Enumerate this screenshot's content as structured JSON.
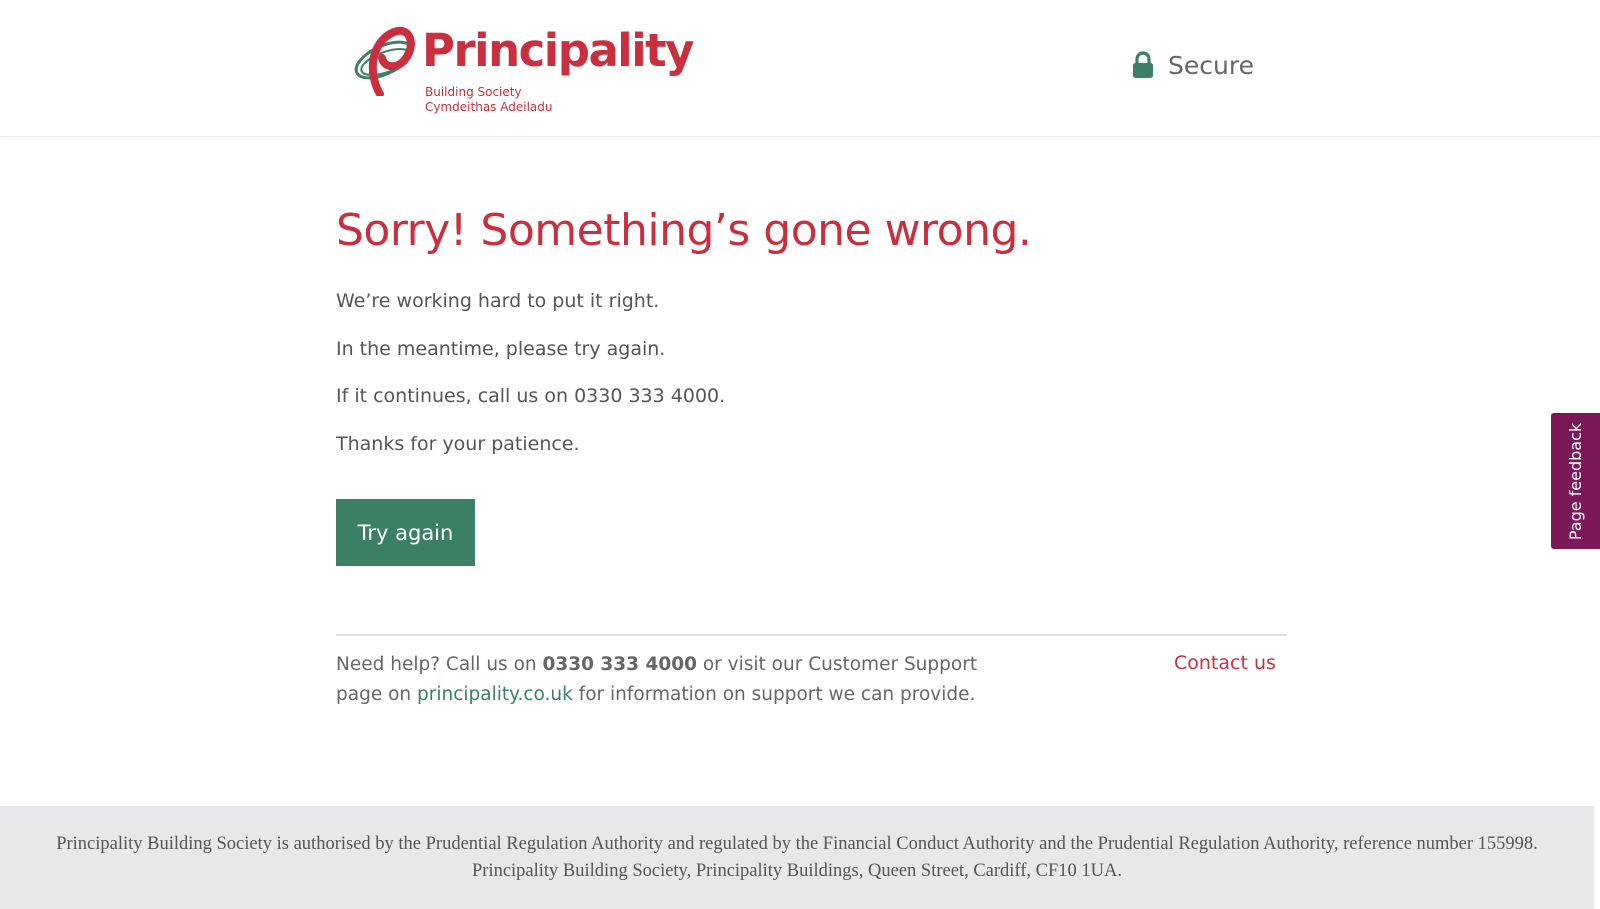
{
  "header": {
    "logo": {
      "name": "Principality",
      "subtitle_line1": "Building Society",
      "subtitle_line2": "Cymdeithas Adeiladu"
    },
    "secure_label": "Secure",
    "secure_icon": "lock-icon"
  },
  "main": {
    "heading": "Sorry! Something’s gone wrong.",
    "paragraphs": [
      "We’re working hard to put it right.",
      "In the meantime, please try again.",
      "If it continues, call us on 0330 333 4000.",
      "Thanks for your patience."
    ],
    "try_again_label": "Try again"
  },
  "help": {
    "prefix": "Need help? Call us on ",
    "phone": "0330 333 4000",
    "middle": " or visit our Customer Support page on ",
    "link_text": "principality.co.uk",
    "suffix": " for information on support we can provide.",
    "contact_label": "Contact us"
  },
  "feedback": {
    "label": "Page feedback"
  },
  "footer": {
    "text": "Principality Building Society is authorised by the Prudential Regulation Authority and regulated by the Financial Conduct Authority and the Prudential Regulation Authority, reference number 155998. Principality Building Society, Principality Buildings, Queen Street, Cardiff, CF10 1UA."
  },
  "colors": {
    "brand_red": "#c8303f",
    "brand_green": "#3b8065",
    "feedback_purple": "#7b1857",
    "footer_bg": "#e8e8ea"
  }
}
